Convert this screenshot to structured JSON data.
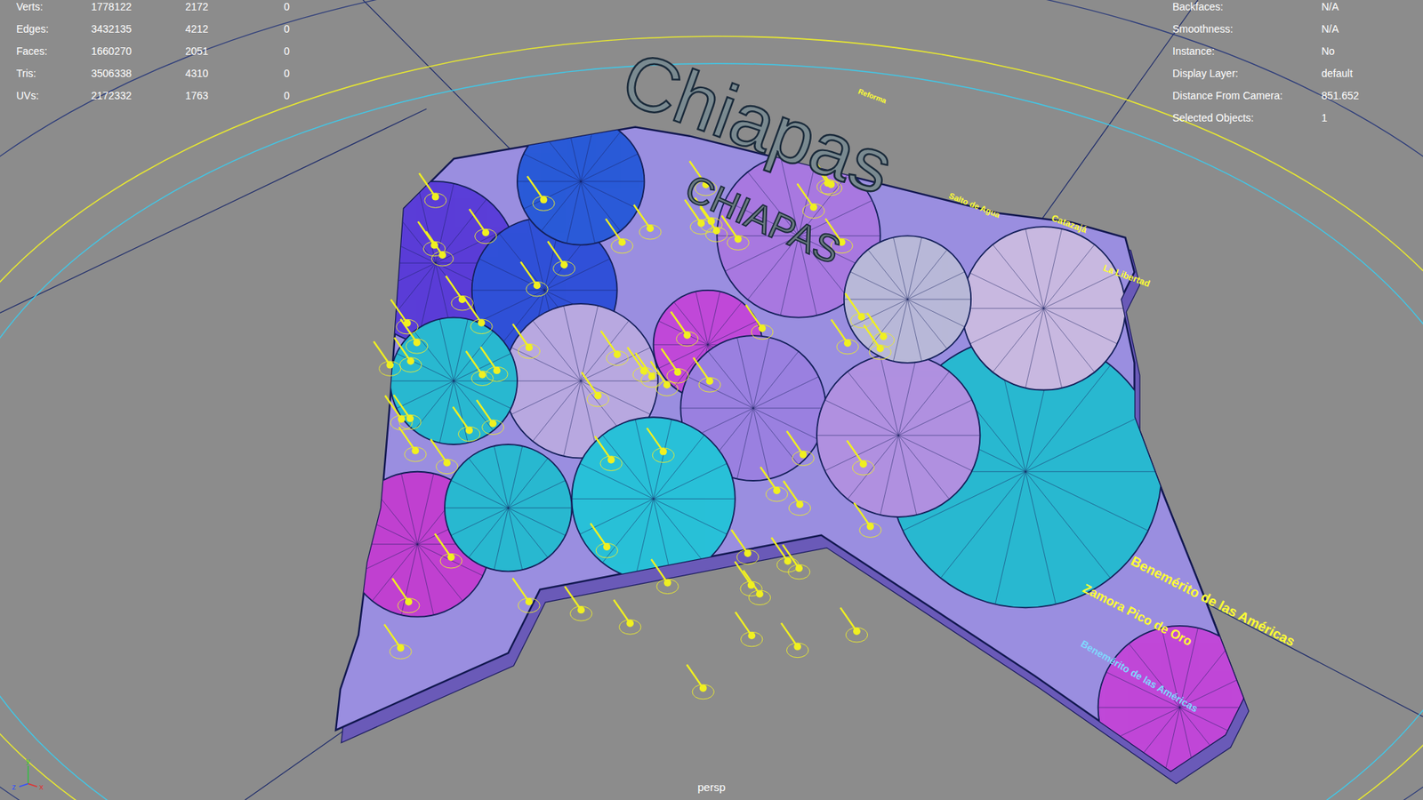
{
  "viewport": {
    "camera": "persp"
  },
  "stats": [
    {
      "label": "Verts:",
      "values": [
        "1778122",
        "2172",
        "0"
      ]
    },
    {
      "label": "Edges:",
      "values": [
        "3432135",
        "4212",
        "0"
      ]
    },
    {
      "label": "Faces:",
      "values": [
        "1660270",
        "2051",
        "0"
      ]
    },
    {
      "label": "Tris:",
      "values": [
        "3506338",
        "4310",
        "0"
      ]
    },
    {
      "label": "UVs:",
      "values": [
        "2172332",
        "1763",
        "0"
      ]
    }
  ],
  "object_info": [
    {
      "label": "Backfaces:",
      "value": "N/A"
    },
    {
      "label": "Smoothness:",
      "value": "N/A"
    },
    {
      "label": "Instance:",
      "value": "No"
    },
    {
      "label": "Display Layer:",
      "value": "default"
    },
    {
      "label": "Distance From Camera:",
      "value": "851.652"
    },
    {
      "label": "Selected Objects:",
      "value": "1"
    }
  ],
  "map": {
    "title": "Chiapas",
    "subtitle": "CHIAPAS",
    "regions": [
      {
        "color": "#5a3ed8"
      },
      {
        "color": "#3050d8"
      },
      {
        "color": "#b8a8e0"
      },
      {
        "color": "#28b8d0"
      },
      {
        "color": "#c048d8"
      },
      {
        "color": "#9a80e0"
      },
      {
        "color": "#28b8d0"
      },
      {
        "color": "#b090e0"
      },
      {
        "color": "#c8b8e0"
      },
      {
        "color": "#2a5ad8"
      },
      {
        "color": "#28c0d8"
      },
      {
        "color": "#a878e0"
      },
      {
        "color": "#c040d0"
      },
      {
        "color": "#b8b8d8"
      },
      {
        "color": "#28b8d0"
      },
      {
        "color": "#c048d8"
      }
    ],
    "labels": [
      {
        "name": "Benemérito de las Américas",
        "color": "#ffff33"
      },
      {
        "name": "Zamora Pico de Oro",
        "color": "#ffff33"
      },
      {
        "name": "La Libertad",
        "color": "#ffff33"
      },
      {
        "name": "Catazajá",
        "color": "#ffff33"
      },
      {
        "name": "Salto de Agua",
        "color": "#ffff33"
      },
      {
        "name": "Reforma",
        "color": "#ffff33"
      },
      {
        "name": "Benemérito de las Américas",
        "color": "#7fd8ff"
      }
    ]
  },
  "axes": [
    {
      "label": "y",
      "color": "#30c040"
    },
    {
      "label": "z",
      "color": "#3050ff"
    },
    {
      "label": "x",
      "color": "#e03030"
    }
  ]
}
